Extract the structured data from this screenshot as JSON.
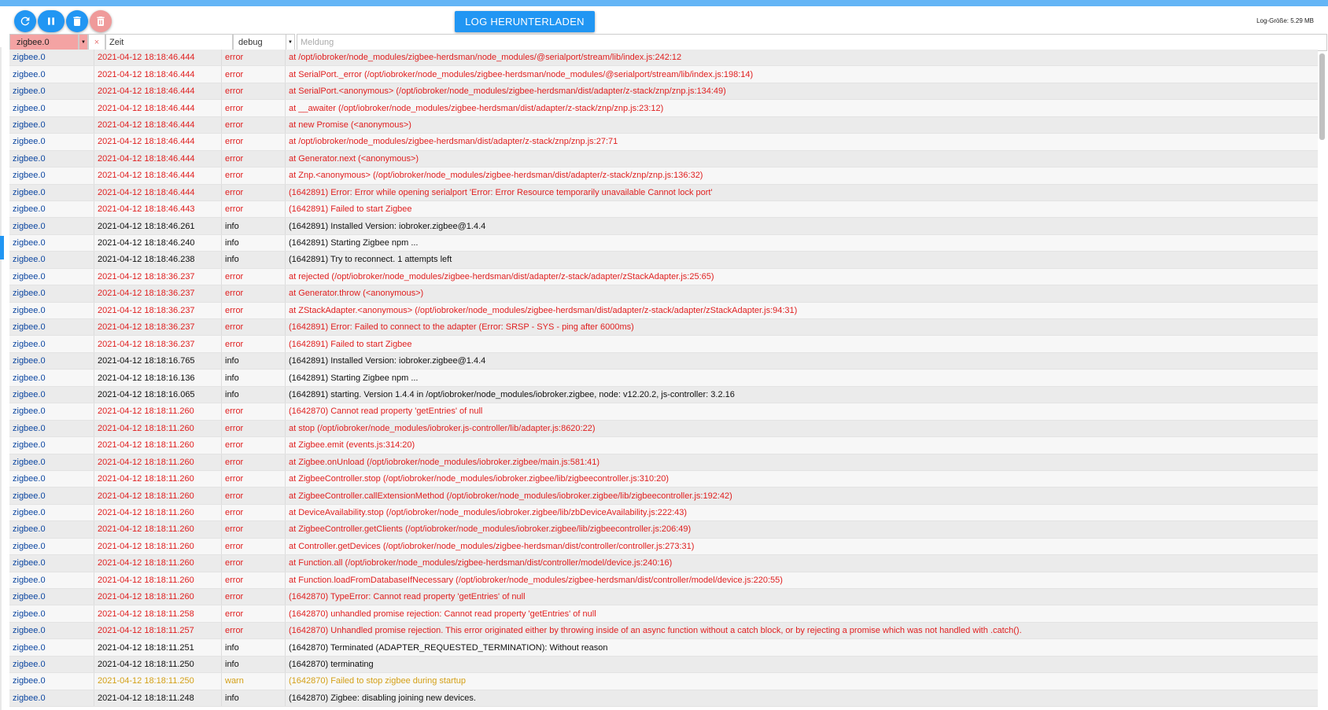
{
  "toolbar": {
    "download_label": "LOG HERUNTERLADEN",
    "log_size": "Log-Größe: 5.29 MB"
  },
  "filters": {
    "source_value": "zigbee.0",
    "clear_symbol": "×",
    "time_value": "Zeit",
    "level_value": "debug",
    "message_placeholder": "Meldung"
  },
  "icons": [
    "refresh-icon",
    "pause-icon",
    "trash-icon",
    "trash-icon"
  ],
  "colors": {
    "accent": "#2196f3",
    "error": "#e02020",
    "warn": "#d4a017",
    "source": "#0d47a1"
  },
  "log": [
    {
      "src": "zigbee.0",
      "time": "2021-04-12 18:18:46.444",
      "level": "error",
      "msg": "at /opt/iobroker/node_modules/zigbee-herdsman/node_modules/@serialport/stream/lib/index.js:242:12"
    },
    {
      "src": "zigbee.0",
      "time": "2021-04-12 18:18:46.444",
      "level": "error",
      "msg": "at SerialPort._error (/opt/iobroker/node_modules/zigbee-herdsman/node_modules/@serialport/stream/lib/index.js:198:14)"
    },
    {
      "src": "zigbee.0",
      "time": "2021-04-12 18:18:46.444",
      "level": "error",
      "msg": "at SerialPort.<anonymous> (/opt/iobroker/node_modules/zigbee-herdsman/dist/adapter/z-stack/znp/znp.js:134:49)"
    },
    {
      "src": "zigbee.0",
      "time": "2021-04-12 18:18:46.444",
      "level": "error",
      "msg": "at __awaiter (/opt/iobroker/node_modules/zigbee-herdsman/dist/adapter/z-stack/znp/znp.js:23:12)"
    },
    {
      "src": "zigbee.0",
      "time": "2021-04-12 18:18:46.444",
      "level": "error",
      "msg": "at new Promise (<anonymous>)"
    },
    {
      "src": "zigbee.0",
      "time": "2021-04-12 18:18:46.444",
      "level": "error",
      "msg": "at /opt/iobroker/node_modules/zigbee-herdsman/dist/adapter/z-stack/znp/znp.js:27:71"
    },
    {
      "src": "zigbee.0",
      "time": "2021-04-12 18:18:46.444",
      "level": "error",
      "msg": "at Generator.next (<anonymous>)"
    },
    {
      "src": "zigbee.0",
      "time": "2021-04-12 18:18:46.444",
      "level": "error",
      "msg": "at Znp.<anonymous> (/opt/iobroker/node_modules/zigbee-herdsman/dist/adapter/z-stack/znp/znp.js:136:32)"
    },
    {
      "src": "zigbee.0",
      "time": "2021-04-12 18:18:46.444",
      "level": "error",
      "msg": "(1642891) Error: Error while opening serialport 'Error: Error Resource temporarily unavailable Cannot lock port'"
    },
    {
      "src": "zigbee.0",
      "time": "2021-04-12 18:18:46.443",
      "level": "error",
      "msg": "(1642891) Failed to start Zigbee"
    },
    {
      "src": "zigbee.0",
      "time": "2021-04-12 18:18:46.261",
      "level": "info",
      "msg": "(1642891) Installed Version: iobroker.zigbee@1.4.4"
    },
    {
      "src": "zigbee.0",
      "time": "2021-04-12 18:18:46.240",
      "level": "info",
      "msg": "(1642891) Starting Zigbee npm ..."
    },
    {
      "src": "zigbee.0",
      "time": "2021-04-12 18:18:46.238",
      "level": "info",
      "msg": "(1642891) Try to reconnect. 1 attempts left"
    },
    {
      "src": "zigbee.0",
      "time": "2021-04-12 18:18:36.237",
      "level": "error",
      "msg": "at rejected (/opt/iobroker/node_modules/zigbee-herdsman/dist/adapter/z-stack/adapter/zStackAdapter.js:25:65)"
    },
    {
      "src": "zigbee.0",
      "time": "2021-04-12 18:18:36.237",
      "level": "error",
      "msg": "at Generator.throw (<anonymous>)"
    },
    {
      "src": "zigbee.0",
      "time": "2021-04-12 18:18:36.237",
      "level": "error",
      "msg": "at ZStackAdapter.<anonymous> (/opt/iobroker/node_modules/zigbee-herdsman/dist/adapter/z-stack/adapter/zStackAdapter.js:94:31)"
    },
    {
      "src": "zigbee.0",
      "time": "2021-04-12 18:18:36.237",
      "level": "error",
      "msg": "(1642891) Error: Failed to connect to the adapter (Error: SRSP - SYS - ping after 6000ms)"
    },
    {
      "src": "zigbee.0",
      "time": "2021-04-12 18:18:36.237",
      "level": "error",
      "msg": "(1642891) Failed to start Zigbee"
    },
    {
      "src": "zigbee.0",
      "time": "2021-04-12 18:18:16.765",
      "level": "info",
      "msg": "(1642891) Installed Version: iobroker.zigbee@1.4.4"
    },
    {
      "src": "zigbee.0",
      "time": "2021-04-12 18:18:16.136",
      "level": "info",
      "msg": "(1642891) Starting Zigbee npm ..."
    },
    {
      "src": "zigbee.0",
      "time": "2021-04-12 18:18:16.065",
      "level": "info",
      "msg": "(1642891) starting. Version 1.4.4 in /opt/iobroker/node_modules/iobroker.zigbee, node: v12.20.2, js-controller: 3.2.16"
    },
    {
      "src": "zigbee.0",
      "time": "2021-04-12 18:18:11.260",
      "level": "error",
      "msg": "(1642870) Cannot read property 'getEntries' of null"
    },
    {
      "src": "zigbee.0",
      "time": "2021-04-12 18:18:11.260",
      "level": "error",
      "msg": "at stop (/opt/iobroker/node_modules/iobroker.js-controller/lib/adapter.js:8620:22)"
    },
    {
      "src": "zigbee.0",
      "time": "2021-04-12 18:18:11.260",
      "level": "error",
      "msg": "at Zigbee.emit (events.js:314:20)"
    },
    {
      "src": "zigbee.0",
      "time": "2021-04-12 18:18:11.260",
      "level": "error",
      "msg": "at Zigbee.onUnload (/opt/iobroker/node_modules/iobroker.zigbee/main.js:581:41)"
    },
    {
      "src": "zigbee.0",
      "time": "2021-04-12 18:18:11.260",
      "level": "error",
      "msg": "at ZigbeeController.stop (/opt/iobroker/node_modules/iobroker.zigbee/lib/zigbeecontroller.js:310:20)"
    },
    {
      "src": "zigbee.0",
      "time": "2021-04-12 18:18:11.260",
      "level": "error",
      "msg": "at ZigbeeController.callExtensionMethod (/opt/iobroker/node_modules/iobroker.zigbee/lib/zigbeecontroller.js:192:42)"
    },
    {
      "src": "zigbee.0",
      "time": "2021-04-12 18:18:11.260",
      "level": "error",
      "msg": "at DeviceAvailability.stop (/opt/iobroker/node_modules/iobroker.zigbee/lib/zbDeviceAvailability.js:222:43)"
    },
    {
      "src": "zigbee.0",
      "time": "2021-04-12 18:18:11.260",
      "level": "error",
      "msg": "at ZigbeeController.getClients (/opt/iobroker/node_modules/iobroker.zigbee/lib/zigbeecontroller.js:206:49)"
    },
    {
      "src": "zigbee.0",
      "time": "2021-04-12 18:18:11.260",
      "level": "error",
      "msg": "at Controller.getDevices (/opt/iobroker/node_modules/zigbee-herdsman/dist/controller/controller.js:273:31)"
    },
    {
      "src": "zigbee.0",
      "time": "2021-04-12 18:18:11.260",
      "level": "error",
      "msg": "at Function.all (/opt/iobroker/node_modules/zigbee-herdsman/dist/controller/model/device.js:240:16)"
    },
    {
      "src": "zigbee.0",
      "time": "2021-04-12 18:18:11.260",
      "level": "error",
      "msg": "at Function.loadFromDatabaseIfNecessary (/opt/iobroker/node_modules/zigbee-herdsman/dist/controller/model/device.js:220:55)"
    },
    {
      "src": "zigbee.0",
      "time": "2021-04-12 18:18:11.260",
      "level": "error",
      "msg": "(1642870) TypeError: Cannot read property 'getEntries' of null"
    },
    {
      "src": "zigbee.0",
      "time": "2021-04-12 18:18:11.258",
      "level": "error",
      "msg": "(1642870) unhandled promise rejection: Cannot read property 'getEntries' of null"
    },
    {
      "src": "zigbee.0",
      "time": "2021-04-12 18:18:11.257",
      "level": "error",
      "msg": "(1642870) Unhandled promise rejection. This error originated either by throwing inside of an async function without a catch block, or by rejecting a promise which was not handled with .catch()."
    },
    {
      "src": "zigbee.0",
      "time": "2021-04-12 18:18:11.251",
      "level": "info",
      "msg": "(1642870) Terminated (ADAPTER_REQUESTED_TERMINATION): Without reason"
    },
    {
      "src": "zigbee.0",
      "time": "2021-04-12 18:18:11.250",
      "level": "info",
      "msg": "(1642870) terminating"
    },
    {
      "src": "zigbee.0",
      "time": "2021-04-12 18:18:11.250",
      "level": "warn",
      "msg": "(1642870) Failed to stop zigbee during startup"
    },
    {
      "src": "zigbee.0",
      "time": "2021-04-12 18:18:11.248",
      "level": "info",
      "msg": "(1642870) Zigbee: disabling joining new devices."
    }
  ]
}
